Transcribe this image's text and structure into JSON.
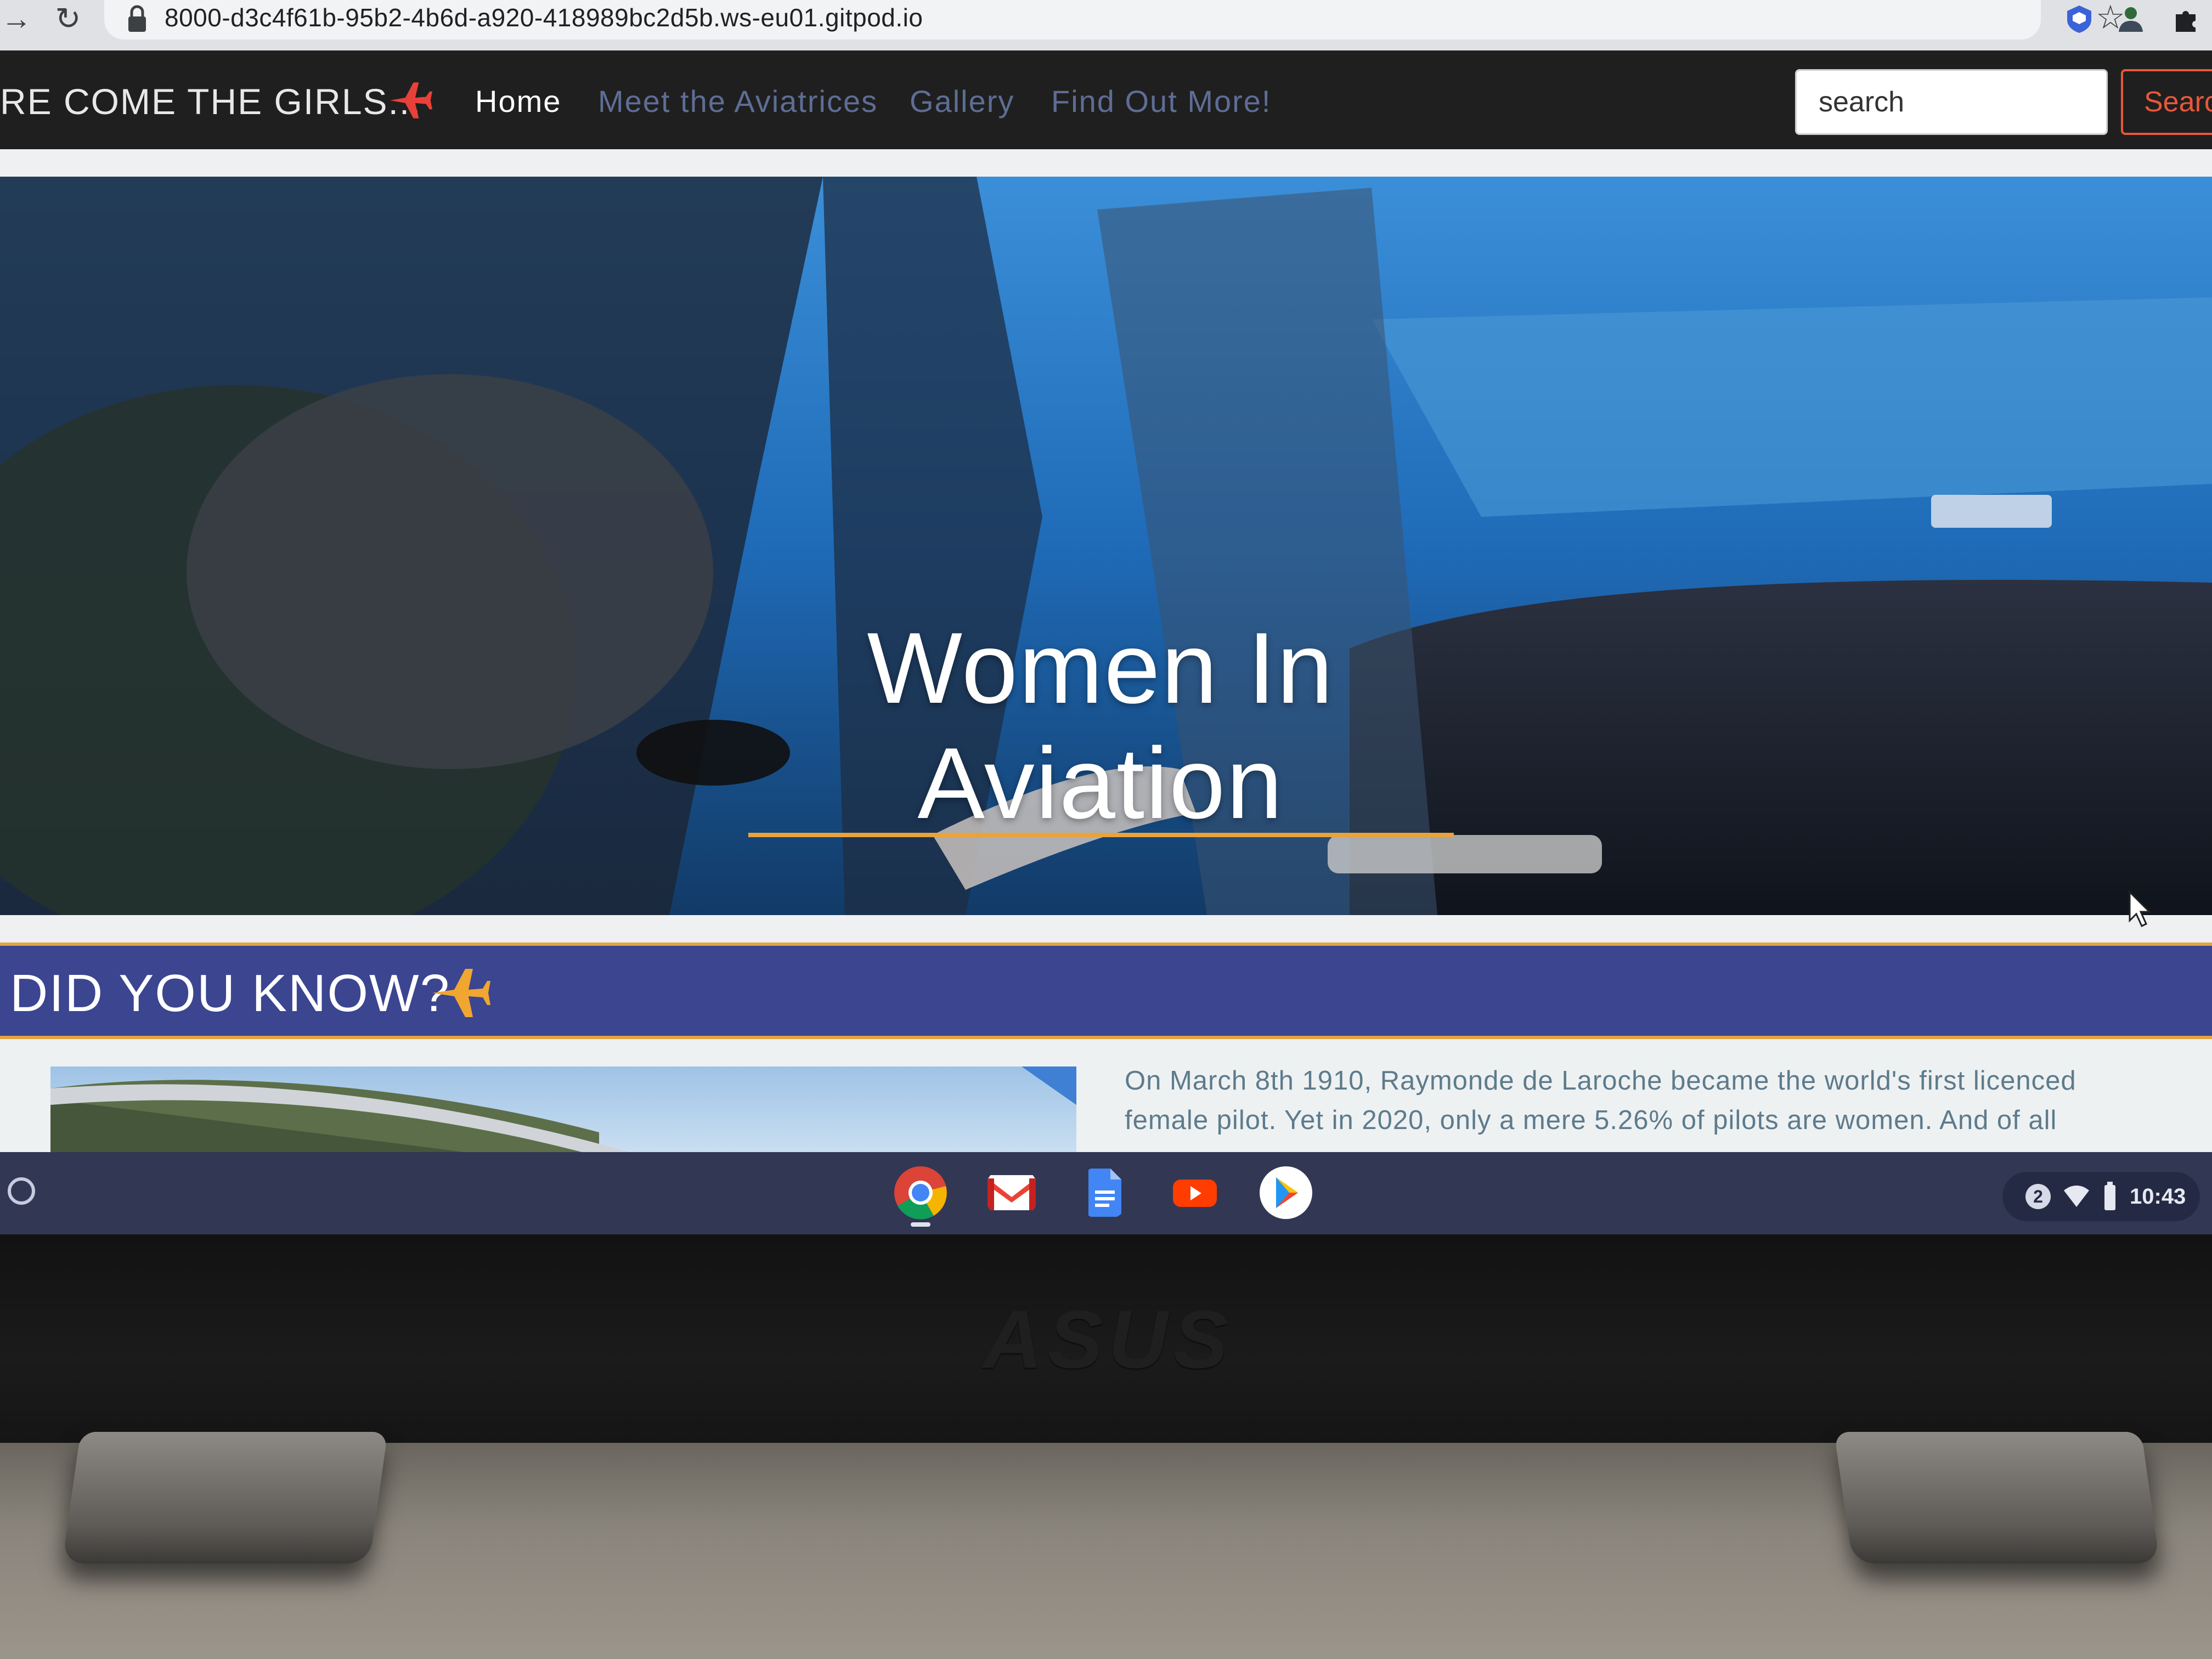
{
  "browser": {
    "url": "8000-d3c4f61b-95b2-4b6d-a920-418989bc2d5b.ws-eu01.gitpod.io",
    "icons": [
      "forward-icon",
      "reload-icon",
      "lock-icon",
      "star-icon",
      "extension-shield-icon",
      "extension-person-icon",
      "extensions-puzzle-icon"
    ]
  },
  "site": {
    "brand": "RE COME THE GIRLS...",
    "nav": {
      "home": "Home",
      "aviatrices": "Meet the Aviatrices",
      "gallery": "Gallery",
      "find_out_more": "Find Out More!"
    },
    "search": {
      "placeholder": "search",
      "button_label": "Searc"
    },
    "hero": {
      "title_line1": "Women In",
      "title_line2": "Aviation"
    },
    "did_you_know": {
      "title": "DID YOU KNOW?",
      "text_line1": "On March 8th 1910, Raymonde de Laroche became the world's first licenced",
      "text_line2": "female pilot. Yet in 2020, only a mere 5.26% of pilots are women. And of all"
    },
    "colors": {
      "accent_orange": "#e9a33a",
      "nav_background": "#1f1f1f",
      "banner_blue": "#3b4590",
      "search_button": "#e8573a"
    }
  },
  "shelf": {
    "apps": [
      "chrome-icon",
      "gmail-icon",
      "docs-icon",
      "youtube-icon",
      "play-store-icon"
    ],
    "notifications": "2",
    "time": "10:43"
  },
  "laptop": {
    "logo": "ASUS"
  }
}
